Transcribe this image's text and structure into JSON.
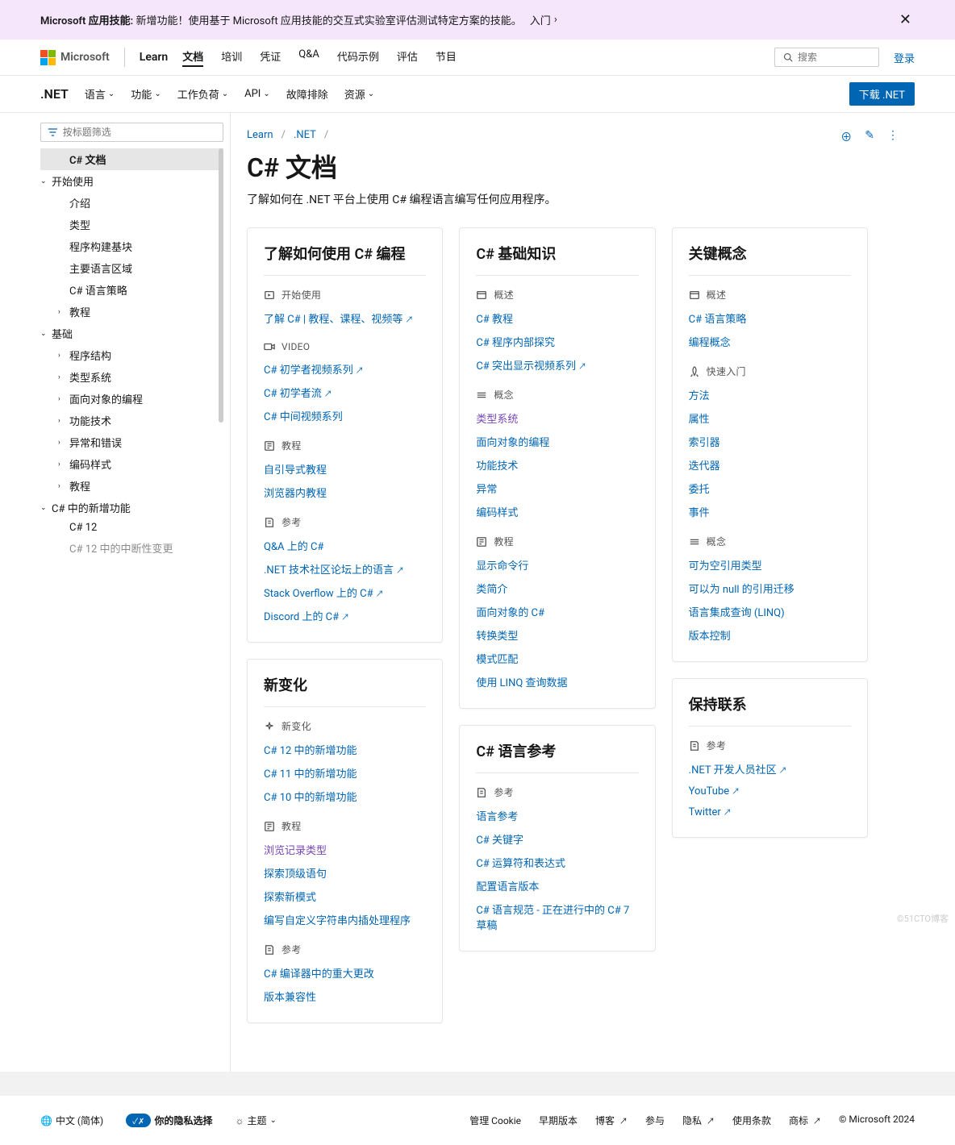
{
  "banner": {
    "title": "Microsoft 应用技能:",
    "text": "新增功能！使用基于 Microsoft 应用技能的交互式实验室评估测试特定方案的技能。",
    "cta": "入门",
    "close_aria": "关闭"
  },
  "topbar": {
    "brand": "Microsoft",
    "learn": "Learn",
    "nav": [
      "文档",
      "培训",
      "凭证",
      "Q&A",
      "代码示例",
      "评估",
      "节目"
    ],
    "search_placeholder": "搜索",
    "signin": "登录"
  },
  "secondbar": {
    "product": ".NET",
    "nav": [
      "语言",
      "功能",
      "工作负荷",
      "API",
      "故障排除",
      "资源"
    ],
    "download": "下载 .NET"
  },
  "sidebar": {
    "filter_placeholder": "按标题筛选",
    "items": [
      {
        "label": "C# 文档",
        "selected": true,
        "level": 1
      },
      {
        "label": "开始使用",
        "level": 0,
        "expanded": true
      },
      {
        "label": "介绍",
        "level": 2
      },
      {
        "label": "类型",
        "level": 2
      },
      {
        "label": "程序构建基块",
        "level": 2
      },
      {
        "label": "主要语言区域",
        "level": 2
      },
      {
        "label": "C# 语言策略",
        "level": 2
      },
      {
        "label": "教程",
        "level": 1,
        "haschev": true
      },
      {
        "label": "基础",
        "level": 0,
        "expanded": true
      },
      {
        "label": "程序结构",
        "level": 1,
        "haschev": true
      },
      {
        "label": "类型系统",
        "level": 1,
        "haschev": true
      },
      {
        "label": "面向对象的编程",
        "level": 1,
        "haschev": true
      },
      {
        "label": "功能技术",
        "level": 1,
        "haschev": true
      },
      {
        "label": "异常和错误",
        "level": 1,
        "haschev": true
      },
      {
        "label": "编码样式",
        "level": 1,
        "haschev": true
      },
      {
        "label": "教程",
        "level": 1,
        "haschev": true
      },
      {
        "label": "C# 中的新增功能",
        "level": 0,
        "expanded": true
      },
      {
        "label": "C# 12",
        "level": 2
      },
      {
        "label": "C# 12 中的中断性变更",
        "level": 2,
        "dimmed": true
      }
    ]
  },
  "breadcrumb": {
    "items": [
      "Learn",
      ".NET"
    ]
  },
  "page": {
    "title": "C# 文档",
    "subtitle": "了解如何在 .NET 平台上使用 C# 编程语言编写任何应用程序。"
  },
  "cards": {
    "col1": [
      {
        "title": "了解如何使用 C# 编程",
        "sections": [
          {
            "head": "开始使用",
            "icon": "start",
            "links": [
              {
                "t": "了解 C# | 教程、课程、视频等",
                "ext": true
              }
            ]
          },
          {
            "head": "VIDEO",
            "icon": "video",
            "links": [
              {
                "t": "C# 初学者视频系列",
                "ext": true
              },
              {
                "t": "C# 初学者流",
                "ext": true
              },
              {
                "t": "C# 中间视频系列"
              }
            ]
          },
          {
            "head": "教程",
            "icon": "tutorial",
            "links": [
              {
                "t": "自引导式教程"
              },
              {
                "t": "浏览器内教程"
              }
            ]
          },
          {
            "head": "参考",
            "icon": "ref",
            "links": [
              {
                "t": "Q&A 上的 C#"
              },
              {
                "t": ".NET 技术社区论坛上的语言",
                "ext": true
              },
              {
                "t": "Stack Overflow 上的 C#",
                "ext": true
              },
              {
                "t": "Discord 上的 C#",
                "ext": true
              }
            ]
          }
        ]
      },
      {
        "title": "新变化",
        "sections": [
          {
            "head": "新变化",
            "icon": "sparkle",
            "links": [
              {
                "t": "C# 12 中的新增功能"
              },
              {
                "t": "C# 11 中的新增功能"
              },
              {
                "t": "C# 10 中的新增功能"
              }
            ]
          },
          {
            "head": "教程",
            "icon": "tutorial",
            "links": [
              {
                "t": "浏览记录类型",
                "visited": true
              },
              {
                "t": "探索顶级语句"
              },
              {
                "t": "探索新模式"
              },
              {
                "t": "编写自定义字符串内插处理程序"
              }
            ]
          },
          {
            "head": "参考",
            "icon": "ref",
            "links": [
              {
                "t": "C# 编译器中的重大更改"
              },
              {
                "t": "版本兼容性"
              }
            ]
          }
        ]
      }
    ],
    "col2": [
      {
        "title": "C# 基础知识",
        "sections": [
          {
            "head": "概述",
            "icon": "overview",
            "links": [
              {
                "t": "C# 教程"
              },
              {
                "t": "C# 程序内部探究"
              },
              {
                "t": "C# 突出显示视频系列",
                "ext": true
              }
            ]
          },
          {
            "head": "概念",
            "icon": "concept",
            "links": [
              {
                "t": "类型系统",
                "visited": true
              },
              {
                "t": "面向对象的编程"
              },
              {
                "t": "功能技术"
              },
              {
                "t": "异常"
              },
              {
                "t": "编码样式"
              }
            ]
          },
          {
            "head": "教程",
            "icon": "tutorial",
            "links": [
              {
                "t": "显示命令行"
              },
              {
                "t": "类简介"
              },
              {
                "t": "面向对象的 C#"
              },
              {
                "t": "转换类型"
              },
              {
                "t": "模式匹配"
              },
              {
                "t": "使用 LINQ 查询数据"
              }
            ]
          }
        ]
      },
      {
        "title": "C# 语言参考",
        "sections": [
          {
            "head": "参考",
            "icon": "ref",
            "links": [
              {
                "t": "语言参考"
              },
              {
                "t": "C# 关键字"
              },
              {
                "t": "C# 运算符和表达式"
              },
              {
                "t": "配置语言版本"
              },
              {
                "t": "C# 语言规范 - 正在进行中的 C# 7 草稿"
              }
            ]
          }
        ]
      }
    ],
    "col3": [
      {
        "title": "关键概念",
        "sections": [
          {
            "head": "概述",
            "icon": "overview",
            "links": [
              {
                "t": "C# 语言策略"
              },
              {
                "t": "编程概念"
              }
            ]
          },
          {
            "head": "快速入门",
            "icon": "rocket",
            "links": [
              {
                "t": "方法"
              },
              {
                "t": "属性"
              },
              {
                "t": "索引器"
              },
              {
                "t": "迭代器"
              },
              {
                "t": "委托"
              },
              {
                "t": "事件"
              }
            ]
          },
          {
            "head": "概念",
            "icon": "concept",
            "links": [
              {
                "t": "可为空引用类型"
              },
              {
                "t": "可以为 null 的引用迁移"
              },
              {
                "t": "语言集成查询 (LINQ)"
              },
              {
                "t": "版本控制"
              }
            ]
          }
        ]
      },
      {
        "title": "保持联系",
        "sections": [
          {
            "head": "参考",
            "icon": "ref",
            "links": [
              {
                "t": ".NET 开发人员社区",
                "ext": true
              },
              {
                "t": "YouTube",
                "ext": true
              },
              {
                "t": "Twitter",
                "ext": true
              }
            ]
          }
        ]
      }
    ]
  },
  "footer": {
    "lang": "中文 (简体)",
    "privacy": "你的隐私选择",
    "theme": "主题",
    "links": [
      "管理 Cookie",
      "早期版本",
      "博客",
      "参与",
      "隐私",
      "使用条款",
      "商标",
      "© Microsoft 2024"
    ],
    "ext_indices": [
      2,
      4,
      6
    ]
  },
  "watermark": "©51CTO博客"
}
